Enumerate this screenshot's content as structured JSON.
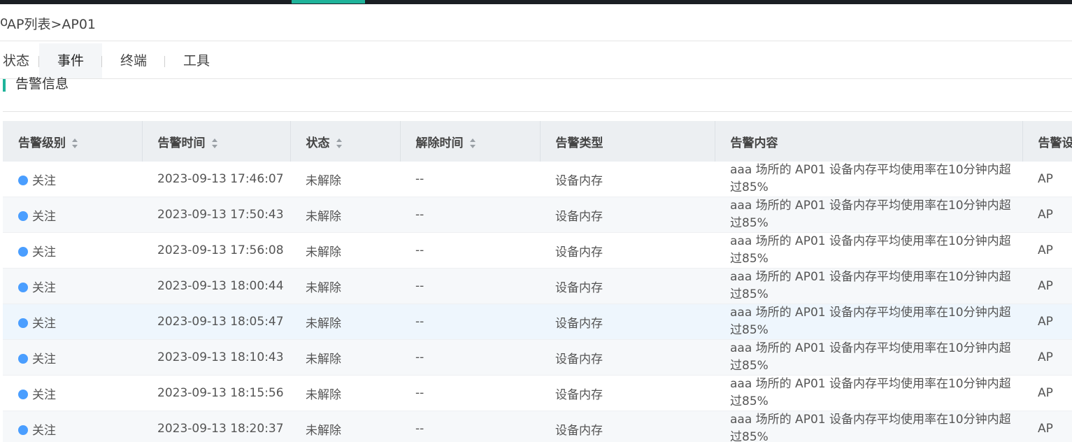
{
  "breadcrumb": {
    "lead": "o",
    "text": "AP列表>AP01"
  },
  "tabs": [
    {
      "label": "状态"
    },
    {
      "label": "事件"
    },
    {
      "label": "终端"
    },
    {
      "label": "工具"
    }
  ],
  "section": {
    "title": "告警信息"
  },
  "table": {
    "headers": [
      "告警级别",
      "告警时间",
      "状态",
      "解除时间",
      "告警类型",
      "告警内容",
      "告警设"
    ],
    "rows": [
      {
        "level": "关注",
        "time": "2023-09-13 17:46:07",
        "status": "未解除",
        "clear": "--",
        "type": "设备内存",
        "content": "aaa 场所的 AP01 设备内存平均使用率在10分钟内超过85%",
        "device": "AP"
      },
      {
        "level": "关注",
        "time": "2023-09-13 17:50:43",
        "status": "未解除",
        "clear": "--",
        "type": "设备内存",
        "content": "aaa 场所的 AP01 设备内存平均使用率在10分钟内超过85%",
        "device": "AP"
      },
      {
        "level": "关注",
        "time": "2023-09-13 17:56:08",
        "status": "未解除",
        "clear": "--",
        "type": "设备内存",
        "content": "aaa 场所的 AP01 设备内存平均使用率在10分钟内超过85%",
        "device": "AP"
      },
      {
        "level": "关注",
        "time": "2023-09-13 18:00:44",
        "status": "未解除",
        "clear": "--",
        "type": "设备内存",
        "content": "aaa 场所的 AP01 设备内存平均使用率在10分钟内超过85%",
        "device": "AP"
      },
      {
        "level": "关注",
        "time": "2023-09-13 18:05:47",
        "status": "未解除",
        "clear": "--",
        "type": "设备内存",
        "content": "aaa 场所的 AP01 设备内存平均使用率在10分钟内超过85%",
        "device": "AP"
      },
      {
        "level": "关注",
        "time": "2023-09-13 18:10:43",
        "status": "未解除",
        "clear": "--",
        "type": "设备内存",
        "content": "aaa 场所的 AP01 设备内存平均使用率在10分钟内超过85%",
        "device": "AP"
      },
      {
        "level": "关注",
        "time": "2023-09-13 18:15:56",
        "status": "未解除",
        "clear": "--",
        "type": "设备内存",
        "content": "aaa 场所的 AP01 设备内存平均使用率在10分钟内超过85%",
        "device": "AP"
      },
      {
        "level": "关注",
        "time": "2023-09-13 18:20:37",
        "status": "未解除",
        "clear": "--",
        "type": "设备内存",
        "content": "aaa 场所的 AP01 设备内存平均使用率在10分钟内超过85%",
        "device": "AP"
      }
    ]
  },
  "colors": {
    "accent": "#1fb39a",
    "level_dot": "#4a9eff",
    "topbar": "#1b1f24"
  }
}
